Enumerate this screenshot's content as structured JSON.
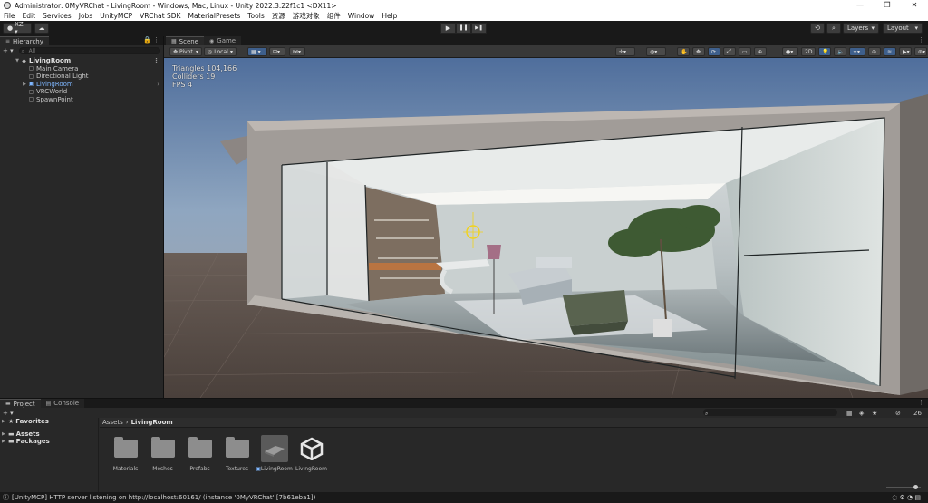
{
  "window": {
    "title": "Administrator: 0MyVRChat - LivingRoom - Windows, Mac, Linux - Unity 2022.3.22f1c1 <DX11>",
    "minimize": "—",
    "maximize": "❐",
    "close": "✕"
  },
  "menu": [
    "File",
    "Edit",
    "Services",
    "Jobs",
    "UnityMCP",
    "VRChat SDK",
    "MaterialPresets",
    "Tools",
    "资源",
    "游戏对象",
    "组件",
    "Window",
    "Help"
  ],
  "toolbar": {
    "account": "XZ ▾",
    "cloud_icon": "cloud-icon",
    "play_icon": "▶",
    "pause_icon": "❚❚",
    "step_icon": "▶❚",
    "layers": "Layers",
    "layout": "Layout"
  },
  "hierarchy": {
    "tab": "Hierarchy",
    "search_placeholder": "All",
    "items": [
      {
        "label": "LivingRoom",
        "depth": 0,
        "kind": "scene"
      },
      {
        "label": "Main Camera",
        "depth": 1,
        "kind": "object"
      },
      {
        "label": "Directional Light",
        "depth": 1,
        "kind": "object"
      },
      {
        "label": "LivingRoom",
        "depth": 1,
        "kind": "prefab"
      },
      {
        "label": "VRCWorld",
        "depth": 1,
        "kind": "object"
      },
      {
        "label": "SpawnPoint",
        "depth": 1,
        "kind": "object"
      }
    ]
  },
  "scene": {
    "tab_scene": "Scene",
    "tab_game": "Game",
    "pivot": "Pivot",
    "local": "Local",
    "mode_2d": "2D",
    "stats": {
      "triangles": "Triangles 104,166",
      "colliders": "Colliders 19",
      "fps": "FPS 4"
    }
  },
  "project": {
    "tab_project": "Project",
    "tab_console": "Console",
    "favorites": "Favorites",
    "assets": "Assets",
    "packages": "Packages",
    "breadcrumb_root": "Assets",
    "breadcrumb_sep": "›",
    "breadcrumb_current": "LivingRoom",
    "count": "26",
    "items": [
      {
        "label": "Materials",
        "type": "folder"
      },
      {
        "label": "Meshes",
        "type": "folder"
      },
      {
        "label": "Prefabs",
        "type": "folder"
      },
      {
        "label": "Textures",
        "type": "folder"
      },
      {
        "label": "LivingRoom",
        "type": "prefab"
      },
      {
        "label": "LivingRoom",
        "type": "scene"
      }
    ]
  },
  "status": {
    "message": "[UnityMCP] HTTP server listening on http://localhost:60161/ (instance '0MyVRChat' [7b61eba1])"
  }
}
